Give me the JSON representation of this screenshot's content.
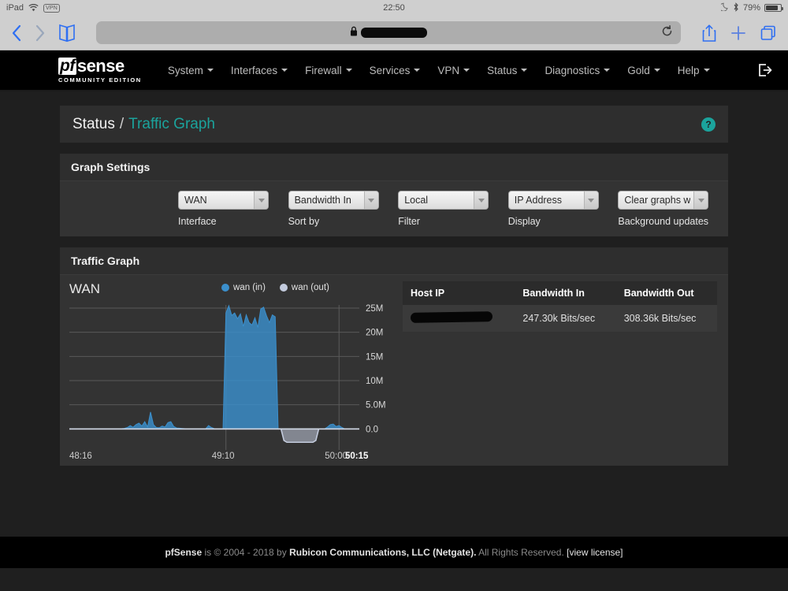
{
  "ios_status": {
    "device": "iPad",
    "wifi_icon": "wifi-icon",
    "vpn_badge": "VPN",
    "time": "22:50",
    "dnd_icon": "moon-icon",
    "bluetooth_icon": "bluetooth-icon",
    "battery_percent": "79%",
    "battery_icon": "battery-icon"
  },
  "safari": {
    "back_icon": "chevron-left-icon",
    "forward_icon": "chevron-right-icon",
    "bookmarks_icon": "book-icon",
    "lock_icon": "lock-icon",
    "url_value": "",
    "url_redacted": true,
    "reload_icon": "reload-icon",
    "share_icon": "share-icon",
    "newtab_icon": "plus-icon",
    "tabs_icon": "tabs-icon"
  },
  "navbar": {
    "logo_pf": "pf",
    "logo_sense": "sense",
    "logo_sub": "COMMUNITY EDITION",
    "menu": [
      {
        "label": "System",
        "caret": true
      },
      {
        "label": "Interfaces",
        "caret": true
      },
      {
        "label": "Firewall",
        "caret": true
      },
      {
        "label": "Services",
        "caret": true
      },
      {
        "label": "VPN",
        "caret": true
      },
      {
        "label": "Status",
        "caret": true
      },
      {
        "label": "Diagnostics",
        "caret": true
      },
      {
        "label": "Gold",
        "caret": true
      },
      {
        "label": "Help",
        "caret": true
      }
    ],
    "logout_icon": "logout-icon"
  },
  "breadcrumb": {
    "parent": "Status",
    "separator": "/",
    "current": "Traffic Graph",
    "help_icon": "?",
    "accent_color": "#1ba39c"
  },
  "graph_settings": {
    "panel_title": "Graph Settings",
    "controls": [
      {
        "value": "WAN",
        "label": "Interface"
      },
      {
        "value": "Bandwidth In",
        "label": "Sort by"
      },
      {
        "value": "Local",
        "label": "Filter"
      },
      {
        "value": "IP Address",
        "label": "Display"
      },
      {
        "value": "Clear graphs w",
        "label": "Background updates"
      }
    ]
  },
  "traffic_graph": {
    "panel_title": "Traffic Graph",
    "hosts_table": {
      "columns": [
        "Host IP",
        "Bandwidth In",
        "Bandwidth Out"
      ],
      "rows": [
        {
          "host_ip": "",
          "host_ip_redacted": true,
          "bandwidth_in": "247.30k Bits/sec",
          "bandwidth_out": "308.36k Bits/sec"
        }
      ]
    }
  },
  "chart_data": {
    "type": "area",
    "title": "WAN",
    "xlabel": "",
    "ylabel": "",
    "grid": true,
    "legend_position": "top-right",
    "legend": [
      {
        "name": "wan (in)",
        "color": "#3b8fcc"
      },
      {
        "name": "wan (out)",
        "color": "#c3cbdd"
      }
    ],
    "ytick_labels": [
      "0.0",
      "5.0M",
      "10M",
      "15M",
      "20M",
      "25M"
    ],
    "ytick_values": [
      0,
      5000000,
      10000000,
      15000000,
      20000000,
      25000000
    ],
    "ylim": [
      -4000000,
      26000000
    ],
    "xtick_labels": [
      "48:16",
      "49:10",
      "50:00",
      "50:15"
    ],
    "xtick_positions": [
      0,
      0.54,
      0.93,
      1.0
    ],
    "x": [
      0,
      1,
      2,
      3,
      4,
      5,
      6,
      7,
      8,
      9,
      10,
      11,
      12,
      13,
      14,
      15,
      16,
      17,
      18,
      19,
      20,
      21,
      22,
      23,
      24,
      25,
      26,
      27,
      28,
      29,
      30,
      31,
      32,
      33,
      34,
      35,
      36,
      37,
      38,
      39,
      40,
      41,
      42,
      43,
      44,
      45,
      46,
      47,
      48,
      49,
      50,
      51,
      52,
      53,
      54,
      55,
      56,
      57,
      58,
      59,
      60,
      61,
      62,
      63,
      64,
      65,
      66,
      67,
      68,
      69,
      70,
      71,
      72,
      73,
      74,
      75,
      76,
      77,
      78,
      79,
      80,
      81,
      82,
      83,
      84,
      85,
      86,
      87,
      88,
      89,
      90,
      91,
      92,
      93,
      94,
      95,
      96,
      97,
      98,
      99,
      100
    ],
    "series": [
      {
        "name": "wan (in)",
        "color": "#3b8fcc",
        "values": [
          0,
          0,
          0,
          0,
          0,
          0,
          0,
          0,
          0,
          0,
          0,
          0,
          0,
          0,
          0,
          0,
          0,
          0,
          60000,
          120000,
          300000,
          700000,
          350000,
          900000,
          1200000,
          600000,
          1500000,
          400000,
          3500000,
          900000,
          300000,
          250000,
          600000,
          400000,
          1300000,
          1500000,
          500000,
          200000,
          150000,
          100000,
          60000,
          30000,
          20000,
          20000,
          20000,
          20000,
          20000,
          30000,
          700000,
          300000,
          60000,
          30000,
          30000,
          30000,
          24000000,
          25500000,
          23500000,
          24000000,
          22800000,
          23800000,
          21200000,
          23600000,
          22000000,
          21500000,
          23000000,
          21000000,
          24800000,
          25200000,
          23400000,
          22000000,
          23600000,
          23200000,
          0,
          0,
          0,
          0,
          0,
          0,
          0,
          0,
          0,
          0,
          0,
          0,
          0,
          0,
          0,
          0,
          0,
          400000,
          900000,
          1000000,
          500000,
          700000,
          300000,
          0,
          0,
          0,
          0,
          0
        ]
      },
      {
        "name": "wan (out)",
        "color": "#c3cbdd",
        "values": [
          0,
          0,
          0,
          0,
          0,
          0,
          0,
          0,
          0,
          0,
          0,
          0,
          0,
          0,
          0,
          0,
          0,
          0,
          0,
          0,
          0,
          0,
          0,
          0,
          0,
          0,
          0,
          0,
          0,
          0,
          0,
          0,
          0,
          0,
          0,
          0,
          0,
          0,
          0,
          0,
          0,
          0,
          0,
          0,
          0,
          0,
          0,
          0,
          0,
          0,
          0,
          0,
          0,
          0,
          0,
          0,
          0,
          0,
          0,
          0,
          0,
          0,
          0,
          0,
          0,
          0,
          0,
          0,
          0,
          0,
          0,
          0,
          0,
          0,
          2600000,
          3000000,
          3000000,
          3000000,
          3000000,
          3000000,
          3000000,
          3000000,
          3000000,
          3000000,
          3000000,
          2600000,
          0,
          0,
          0,
          0,
          0,
          0,
          0,
          0,
          0,
          0,
          0,
          0,
          0
        ],
        "note": "rendered below the zero baseline (mirrored)"
      }
    ]
  },
  "footer": {
    "brand": "pfSense",
    "text_1": "is © 2004 - 2018 by",
    "company": "Rubicon Communications, LLC (Netgate).",
    "text_2": "All Rights Reserved.",
    "license": "[view license]"
  }
}
